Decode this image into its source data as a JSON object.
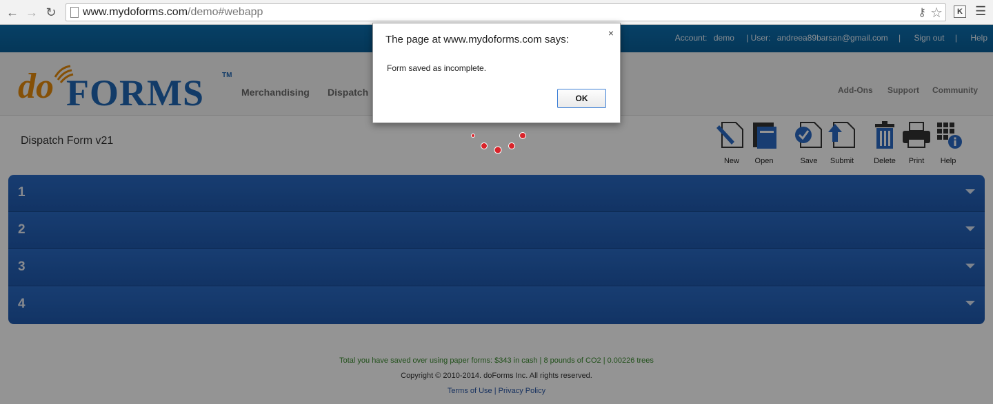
{
  "browser": {
    "url_host": "www.mydoforms.com",
    "url_path": "/demo#webapp",
    "extension_label": "K"
  },
  "topbar": {
    "account_label": "Account:",
    "account_value": "demo",
    "user_label": "| User:",
    "user_value": "andreea89barsan@gmail.com",
    "sep1": "|",
    "signout": "Sign out",
    "sep2": "|",
    "help": "Help"
  },
  "logo": {
    "do": "do",
    "forms": "FORMS",
    "tm": "TM"
  },
  "nav": {
    "main": [
      "Merchandising",
      "Dispatch"
    ],
    "right": [
      "Add-Ons",
      "Support",
      "Community"
    ]
  },
  "form": {
    "title": "Dispatch Form v21"
  },
  "toolbar": {
    "new": "New",
    "open": "Open",
    "save": "Save",
    "submit": "Submit",
    "delete": "Delete",
    "print": "Print",
    "help": "Help"
  },
  "sections": [
    "1",
    "2",
    "3",
    "4"
  ],
  "footer": {
    "savings": "Total you have saved over using paper forms: $343  in cash | 8  pounds of CO2 | 0.00226  trees",
    "copyright": "Copyright © 2010-2014. doForms Inc. All rights reserved.",
    "terms": "Terms of Use",
    "sep": "|",
    "privacy": "Privacy Policy"
  },
  "dialog": {
    "title": "The page at www.mydoforms.com says:",
    "message": "Form saved as incomplete.",
    "ok_label": "OK",
    "close_glyph": "×"
  },
  "colors": {
    "topbar": "#0b6fb0",
    "accordion": "#2a6ac4",
    "logo_orange": "#e58a0c",
    "logo_blue": "#1f67b3",
    "spinner": "#d9232a"
  }
}
